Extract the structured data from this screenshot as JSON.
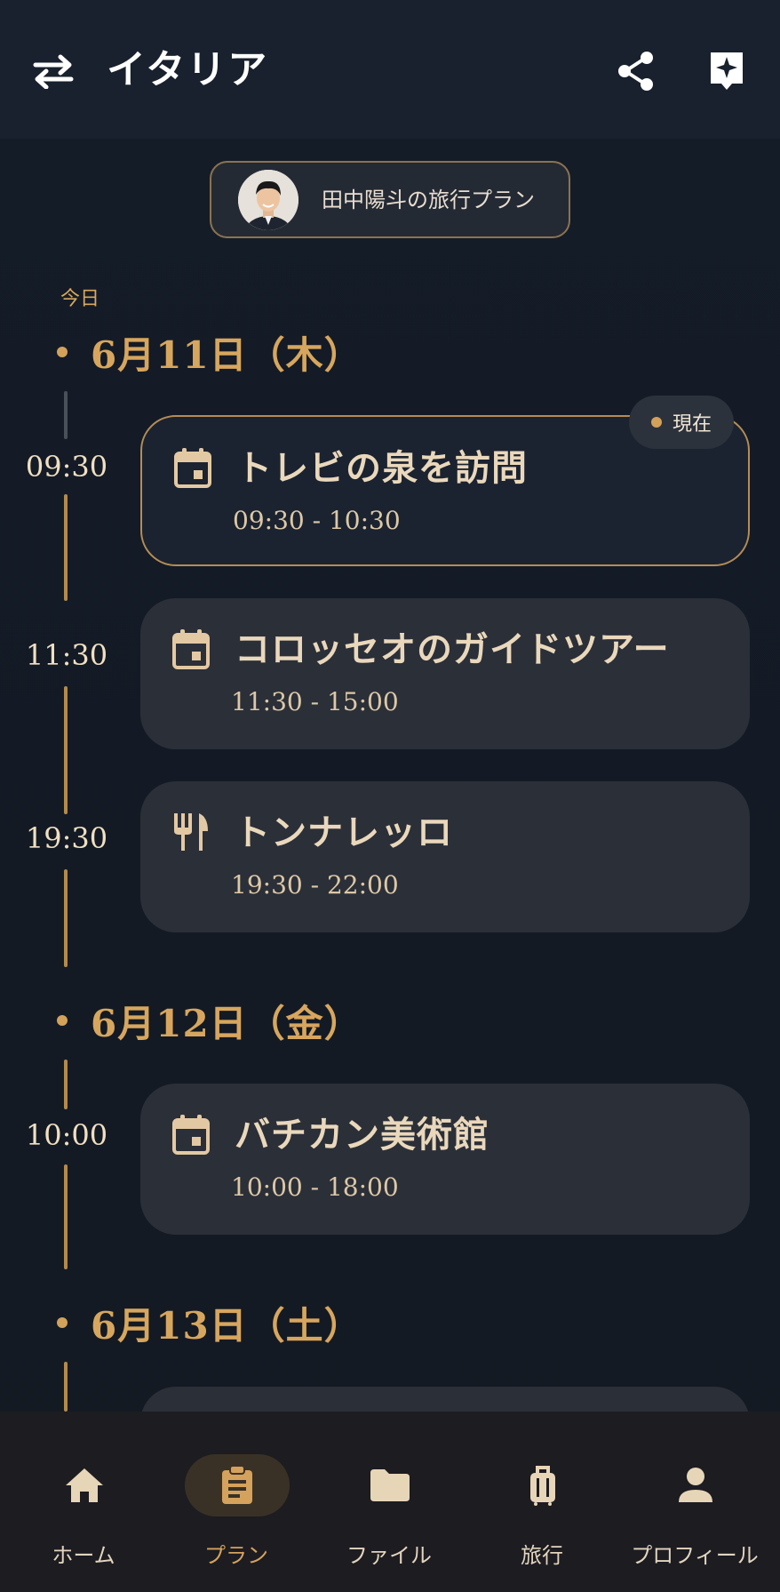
{
  "header": {
    "title": "イタリア",
    "icons": {
      "swap": "swap-icon",
      "share": "share-icon",
      "ai": "sparkle-bookmark-icon"
    }
  },
  "owner": {
    "label": "田中陽斗の旅行プラン"
  },
  "today_label": "今日",
  "days": [
    {
      "date": "6月11日（木）",
      "events": [
        {
          "time": "09:30",
          "title": "トレビの泉を訪問",
          "range": "09:30 - 10:30",
          "icon": "calendar-icon",
          "current": true,
          "badge": "現在"
        },
        {
          "time": "11:30",
          "title": "コロッセオのガイドツアー",
          "range": "11:30 - 15:00",
          "icon": "calendar-icon",
          "current": false
        },
        {
          "time": "19:30",
          "title": "トンナレッロ",
          "range": "19:30 - 22:00",
          "icon": "restaurant-icon",
          "current": false
        }
      ]
    },
    {
      "date": "6月12日（金）",
      "events": [
        {
          "time": "10:00",
          "title": "バチカン美術館",
          "range": "10:00 - 18:00",
          "icon": "calendar-icon",
          "current": false
        }
      ]
    },
    {
      "date": "6月13日（土）",
      "events": []
    }
  ],
  "nav": [
    {
      "label": "ホーム",
      "icon": "home-icon",
      "active": false
    },
    {
      "label": "プラン",
      "icon": "clipboard-icon",
      "active": true
    },
    {
      "label": "ファイル",
      "icon": "folder-icon",
      "active": false
    },
    {
      "label": "旅行",
      "icon": "luggage-icon",
      "active": false
    },
    {
      "label": "プロフィール",
      "icon": "person-icon",
      "active": false
    }
  ],
  "colors": {
    "accent": "#d4a25c",
    "background": "#141c27",
    "card": "#2b2f38"
  }
}
